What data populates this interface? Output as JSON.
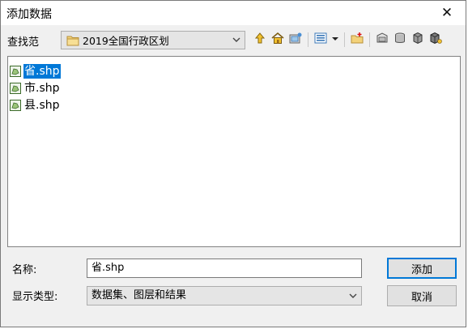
{
  "window": {
    "title": "添加数据",
    "close_glyph": "✕"
  },
  "lookin": {
    "label": "查找范",
    "value": "2019全国行政区划"
  },
  "toolbar": {
    "icons": [
      "go-up-icon",
      "home-icon",
      "connect-folder-icon",
      "list-view-icon",
      "view-dropdown-icon",
      "new-folder-icon",
      "catalog-icon",
      "database-icon",
      "server-icon",
      "server-connect-icon"
    ]
  },
  "files": [
    {
      "name": "省.shp",
      "selected": true
    },
    {
      "name": "市.shp",
      "selected": false
    },
    {
      "name": "县.shp",
      "selected": false
    }
  ],
  "name_field": {
    "label": "名称:",
    "value": "省.shp"
  },
  "type_field": {
    "label": "显示类型:",
    "value": "数据集、图层和结果"
  },
  "buttons": {
    "add": "添加",
    "cancel": "取消"
  },
  "colors": {
    "selection": "#0078d7",
    "dialog_bg": "#f0f0f0"
  }
}
